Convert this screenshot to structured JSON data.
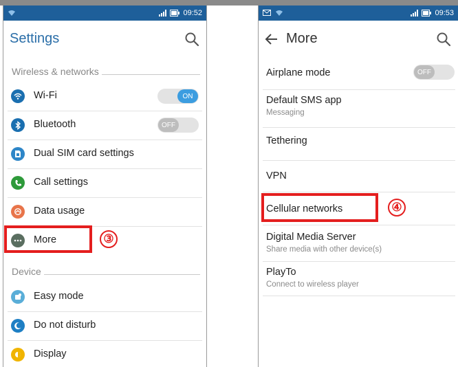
{
  "left": {
    "status": {
      "time": "09:52"
    },
    "title": "Settings",
    "section_wireless": "Wireless & networks",
    "section_device": "Device",
    "items": [
      {
        "label": "Wi-Fi",
        "icon": "wifi-icon",
        "color": "#1a6fb0",
        "toggle": "ON"
      },
      {
        "label": "Bluetooth",
        "icon": "bluetooth-icon",
        "color": "#1a6fb0",
        "toggle": "OFF"
      },
      {
        "label": "Dual SIM card settings",
        "icon": "sim-card-icon",
        "color": "#2e86c8"
      },
      {
        "label": "Call settings",
        "icon": "phone-icon",
        "color": "#2e9a3a"
      },
      {
        "label": "Data usage",
        "icon": "data-usage-icon",
        "color": "#e8744a"
      },
      {
        "label": "More",
        "icon": "more-icon",
        "color": "#5a6e60"
      },
      {
        "label": "Easy mode",
        "icon": "easy-mode-icon",
        "color": "#5aaed8"
      },
      {
        "label": "Do not disturb",
        "icon": "do-not-disturb-icon",
        "color": "#1e7fc4"
      },
      {
        "label": "Display",
        "icon": "display-icon",
        "color": "#f0b400"
      }
    ],
    "step_marker": "③"
  },
  "right": {
    "status": {
      "time": "09:53"
    },
    "title": "More",
    "items": [
      {
        "label": "Airplane mode",
        "toggle": "OFF"
      },
      {
        "label": "Default SMS app",
        "sub": "Messaging"
      },
      {
        "label": "Tethering"
      },
      {
        "label": "VPN"
      },
      {
        "label": "Cellular networks"
      },
      {
        "label": "Digital Media Server",
        "sub": "Share media with other device(s)"
      },
      {
        "label": "PlayTo",
        "sub": "Connect to wireless player"
      }
    ],
    "step_marker": "④"
  },
  "colors": {
    "statusbar": "#1e5f9a",
    "accent": "#2a6ea8",
    "highlight": "#e41e1e",
    "toggle_on": "#3c9de0"
  }
}
